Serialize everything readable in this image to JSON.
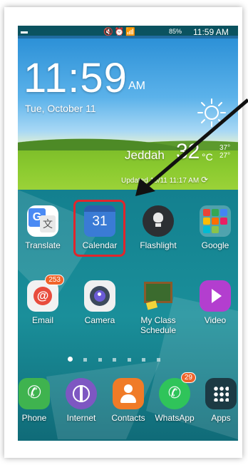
{
  "status_bar": {
    "battery": "85%",
    "time": "11:59 AM"
  },
  "clock_widget": {
    "time": "11:59",
    "ampm": "AM",
    "date": "Tue, October 11",
    "city": "Jeddah",
    "temperature": "32",
    "unit": "°C",
    "high": "37°",
    "low": "27°",
    "updated": "Updated 10/11 11:17 AM"
  },
  "apps_row1": [
    {
      "label": "Translate",
      "icon": "google-translate-icon"
    },
    {
      "label": "Calendar",
      "icon": "calendar-icon",
      "calendar_day": "31"
    },
    {
      "label": "Flashlight",
      "icon": "flashlight-icon"
    },
    {
      "label": "Google",
      "icon": "google-folder-icon"
    }
  ],
  "apps_row2": [
    {
      "label": "Email",
      "icon": "email-icon",
      "badge": "253"
    },
    {
      "label": "Camera",
      "icon": "camera-icon"
    },
    {
      "label": "My Class Schedule",
      "icon": "chalkboard-icon"
    },
    {
      "label": "Video",
      "icon": "video-icon"
    }
  ],
  "dock": [
    {
      "label": "Phone",
      "icon": "phone-icon"
    },
    {
      "label": "Internet",
      "icon": "internet-globe-icon"
    },
    {
      "label": "Contacts",
      "icon": "contacts-icon"
    },
    {
      "label": "WhatsApp",
      "icon": "whatsapp-icon",
      "badge": "29"
    },
    {
      "label": "Apps",
      "icon": "apps-grid-icon"
    }
  ],
  "colors": {
    "highlight": "#e0262c",
    "badge": "#f0642a"
  }
}
